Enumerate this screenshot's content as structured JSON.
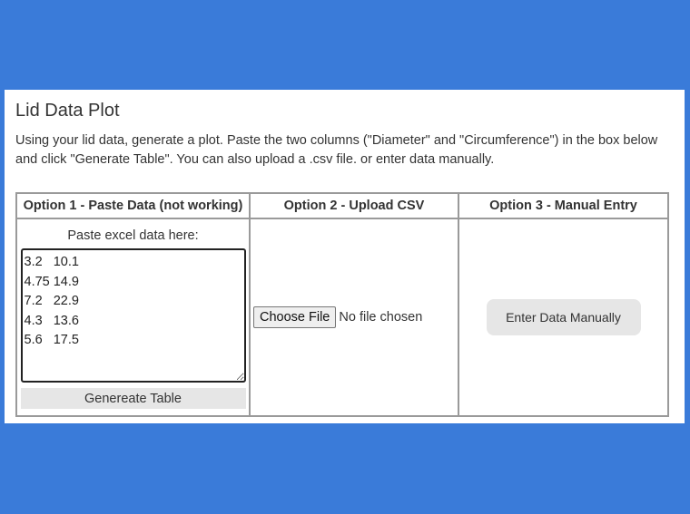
{
  "page": {
    "title": "Lid Data Plot",
    "description": "Using your lid data, generate a plot. Paste the two columns (\"Diameter\" and \"Circumference\") in the box below and click \"Generate Table\". You can also upload a .csv file. or enter data manually."
  },
  "options": {
    "headers": [
      "Option 1 - Paste Data (not working)",
      "Option 2 - Upload CSV",
      "Option 3 - Manual Entry"
    ],
    "paste": {
      "label": "Paste excel data here:",
      "value": "3.2\t10.1\n4.75\t14.9\n7.2\t22.9\n4.3\t13.6\n5.6\t17.5",
      "button_label": "Genereate Table"
    },
    "upload": {
      "button_label": "Choose File",
      "status": "No file chosen"
    },
    "manual": {
      "button_label": "Enter Data Manually"
    }
  },
  "colors": {
    "background": "#3a7bd9",
    "card": "#ffffff",
    "button_gray": "#e6e6e6"
  }
}
